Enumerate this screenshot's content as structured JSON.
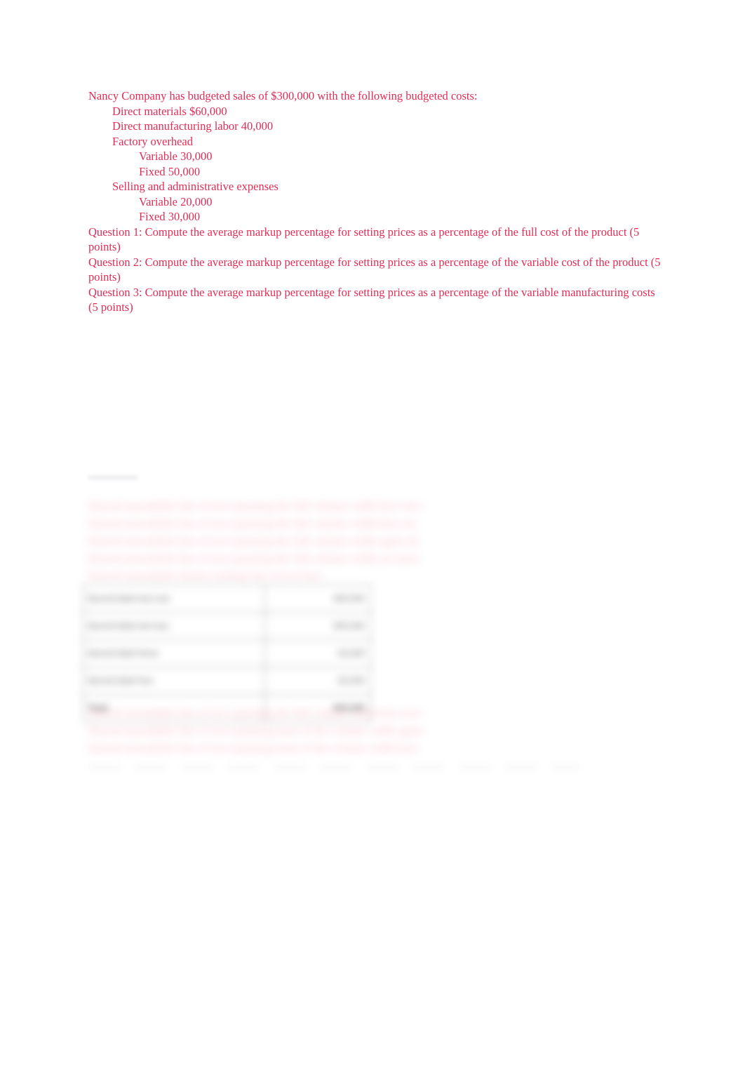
{
  "document": {
    "intro": "Nancy Company has budgeted sales of $300,000 with the following budgeted costs:",
    "cost_items": [
      {
        "level": 1,
        "text": "Direct materials $60,000"
      },
      {
        "level": 1,
        "text": "Direct manufacturing labor 40,000"
      },
      {
        "level": 1,
        "text": "Factory overhead"
      },
      {
        "level": 2,
        "text": "Variable 30,000"
      },
      {
        "level": 2,
        "text": "Fixed 50,000"
      },
      {
        "level": 1,
        "text": "Selling and administrative expenses"
      },
      {
        "level": 2,
        "text": "Variable 20,000"
      },
      {
        "level": 2,
        "text": "Fixed 30,000"
      }
    ],
    "questions": [
      "Question 1: Compute the average markup percentage for setting prices as a percentage of the full cost of the product (5 points)",
      "Question 2: Compute the average markup percentage for setting prices as a percentage of the variable cost of the product (5 points)",
      "Question 3: Compute the average markup percentage for setting prices as a percentage of the variable manufacturing costs (5 points)"
    ]
  },
  "redacted": {
    "note": "blurred-unreadable",
    "paragraph_top_lines": [
      "blurred unreadable line of text spanning the full column width here now",
      "blurred unreadable line of text spanning the full column width here too",
      "blurred unreadable line of text spanning the full column width again ok",
      "blurred unreadable line of text spanning the full column width yet more",
      "blurred unreadable shorter trailing line of text here"
    ],
    "paragraph_bottom_lines": [
      "blurred unreadable line of text spanning the full column width here now",
      "blurred unreadable line of text spanning most of the column width again",
      "blurred unreadable line of text spanning most of the column width here"
    ],
    "table_rows": [
      {
        "label": "blurred label text one",
        "value": "000,000"
      },
      {
        "label": "blurred label text two",
        "value": "000,000"
      },
      {
        "label": "blurred label three",
        "value": "00,000"
      },
      {
        "label": "blurred label four",
        "value": "00,000"
      },
      {
        "label": "Total",
        "value": "000,000"
      }
    ]
  },
  "colors": {
    "text_accent": "#e12d55",
    "redacted_text": "#f2899f",
    "table_border": "#8d8d8d",
    "page_background": "#ffffff"
  }
}
